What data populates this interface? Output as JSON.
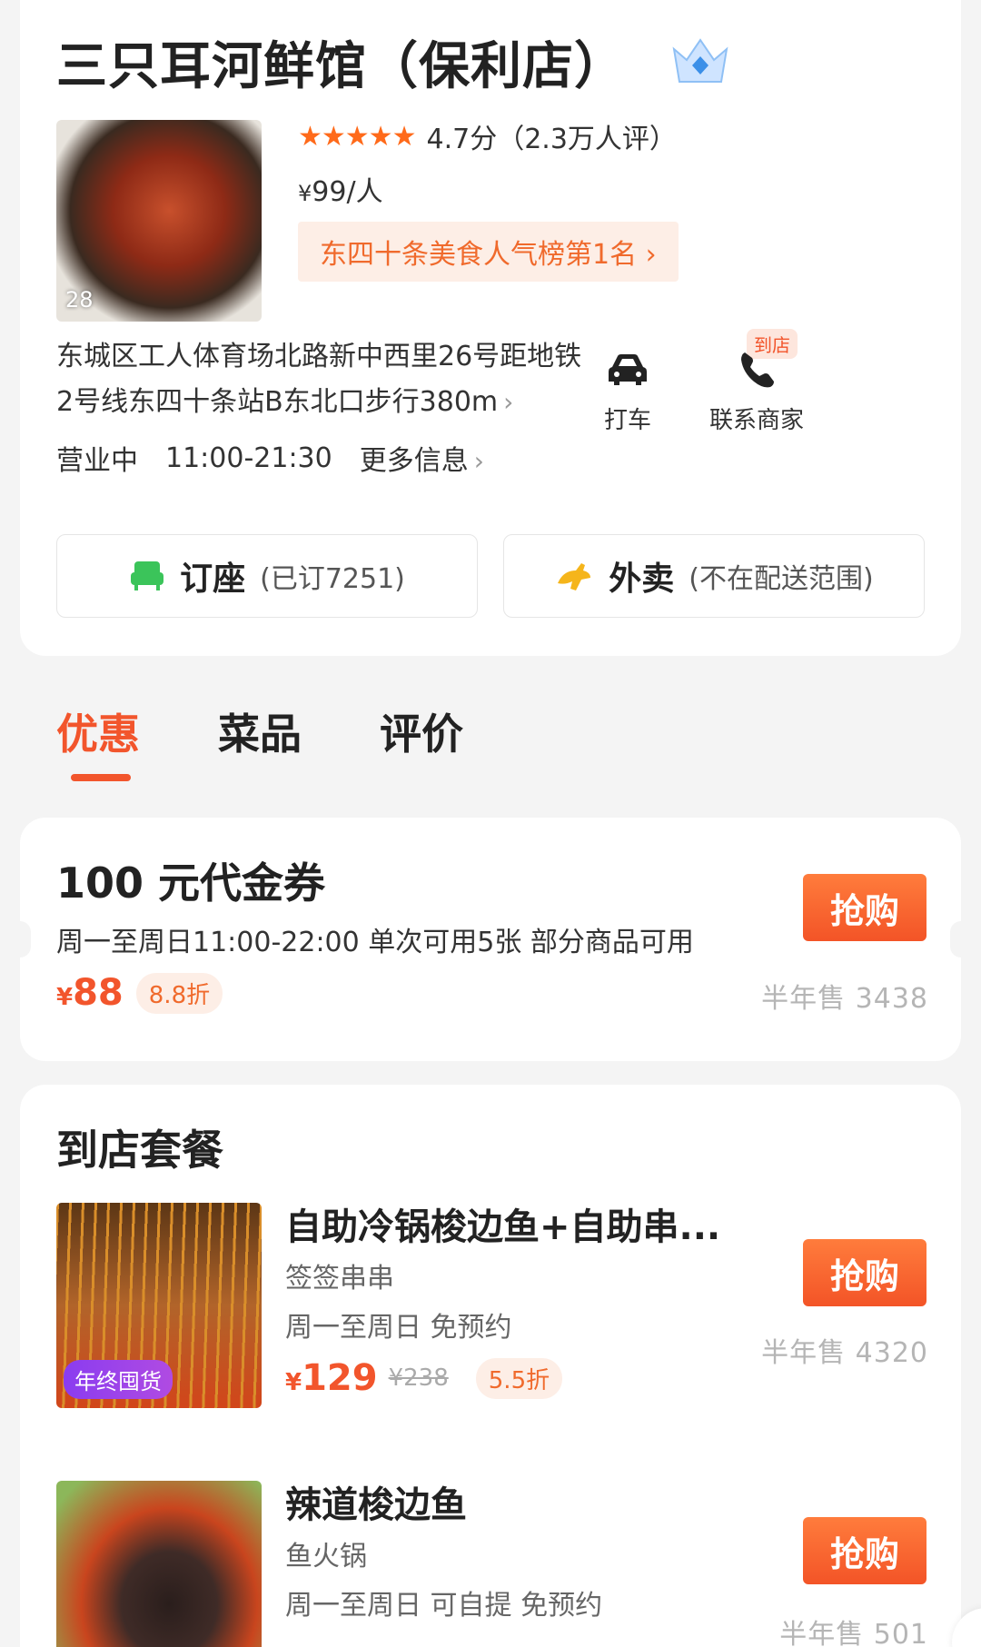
{
  "shop": {
    "title": "三只耳河鲜馆（保利店）",
    "photo_count": "28",
    "stars": "★★★★★",
    "rating_text": "4.7分（2.3万人评）",
    "price_yen": "¥",
    "price": "99/人",
    "rank": "东四十条美食人气榜第1名 ›",
    "address_line1": "东城区工人体育场北路新中西里26号距地铁",
    "address_line2": "2号线东四十条站B东北口步行380m",
    "address_chevron": "›",
    "taxi_tag": "到店",
    "taxi_label": "打车",
    "contact_label": "联系商家",
    "status": "营业中",
    "hours": "11:00-21:30",
    "more_info": "更多信息",
    "more_chevron": "›",
    "reserve_label": "订座",
    "reserve_sub": "(已订7251)",
    "delivery_label": "外卖",
    "delivery_sub": "(不在配送范围)"
  },
  "tabs": [
    {
      "label": "优惠",
      "active": true
    },
    {
      "label": "菜品",
      "active": false
    },
    {
      "label": "评价",
      "active": false
    }
  ],
  "voucher": {
    "title": "100 元代金券",
    "desc": "周一至周日11:00-22:00 单次可用5张 部分商品可用",
    "yen": "¥",
    "price": "88",
    "discount": "8.8折",
    "buy_label": "抢购",
    "sold": "半年售 3438"
  },
  "packages": {
    "section_title": "到店套餐",
    "items": [
      {
        "name": "自助冷锅梭边鱼+自助串...",
        "category": "签签串串",
        "terms": "周一至周日  免预约",
        "yen": "¥",
        "price": "129",
        "old_price": "¥238",
        "discount": "5.5折",
        "tag": "年终囤货",
        "buy_label": "抢购",
        "sold": "半年售 4320"
      },
      {
        "name": "辣道梭边鱼",
        "category": "鱼火锅",
        "terms": "周一至周日  可自提  免预约",
        "buy_label": "抢购",
        "sold": "半年售 501"
      }
    ]
  },
  "colors": {
    "accent": "#f2552c",
    "accent_light": "#fdeee6",
    "star": "#ff6a1a",
    "reserve_icon": "#3bc45a",
    "delivery_icon": "#f5b51b"
  }
}
